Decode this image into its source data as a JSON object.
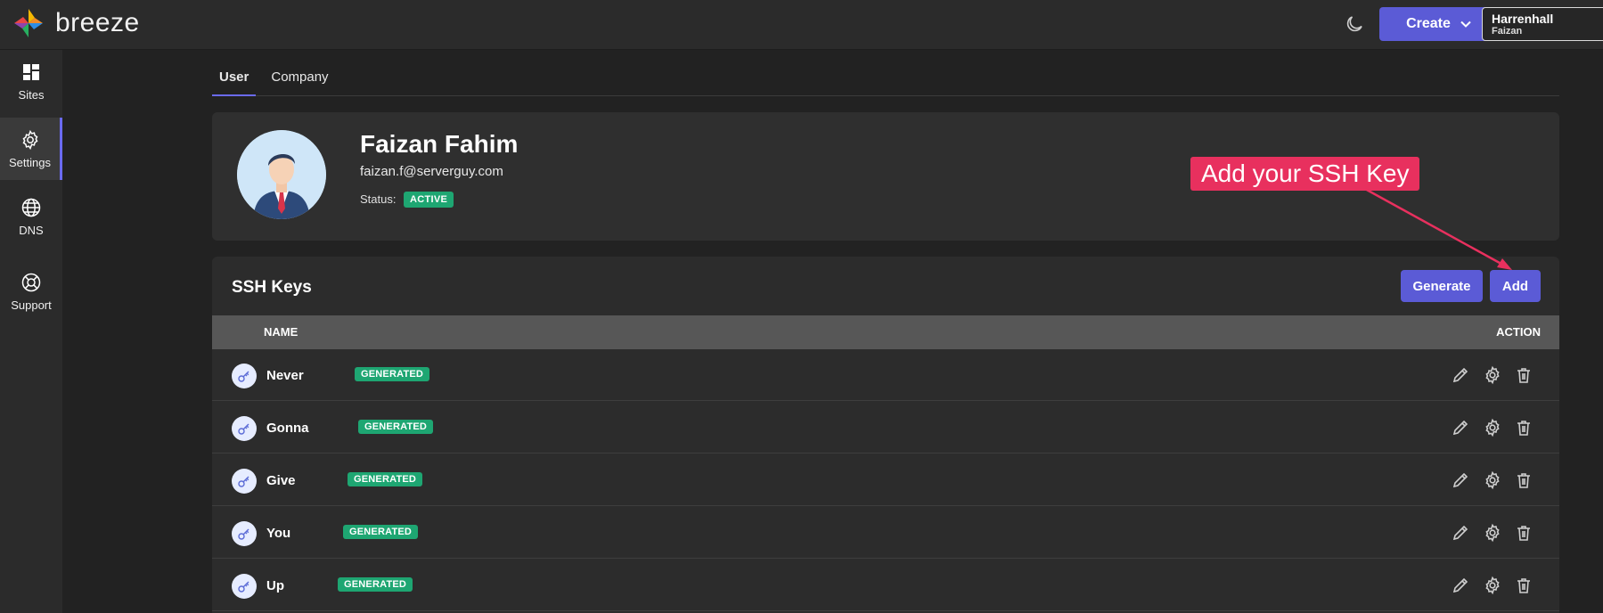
{
  "app": {
    "brand": "breeze",
    "create_label": "Create",
    "org_name": "Harrenhall",
    "org_user": "Faizan"
  },
  "sidebar": {
    "items": [
      {
        "label": "Sites",
        "icon": "grid-icon"
      },
      {
        "label": "Settings",
        "icon": "gear-icon"
      },
      {
        "label": "DNS",
        "icon": "globe-icon"
      },
      {
        "label": "Support",
        "icon": "lifebuoy-icon"
      }
    ],
    "active": "Settings"
  },
  "tabs": [
    {
      "label": "User",
      "active": true
    },
    {
      "label": "Company",
      "active": false
    }
  ],
  "profile": {
    "name": "Faizan Fahim",
    "email": "faizan.f@serverguy.com",
    "status_label": "Status:",
    "status": "ACTIVE"
  },
  "annotation": {
    "text": "Add your SSH Key"
  },
  "ssh_keys": {
    "title": "SSH Keys",
    "generate_label": "Generate",
    "add_label": "Add",
    "columns": {
      "name": "NAME",
      "action": "ACTION"
    },
    "rows": [
      {
        "name": "Never",
        "badge": "GENERATED"
      },
      {
        "name": "Gonna",
        "badge": "GENERATED"
      },
      {
        "name": "Give",
        "badge": "GENERATED"
      },
      {
        "name": "You",
        "badge": "GENERATED"
      },
      {
        "name": "Up",
        "badge": "GENERATED"
      }
    ]
  },
  "colors": {
    "accent": "#5b5bd6",
    "success": "#1ea672",
    "annotation": "#e8305e",
    "background": "#222222"
  }
}
